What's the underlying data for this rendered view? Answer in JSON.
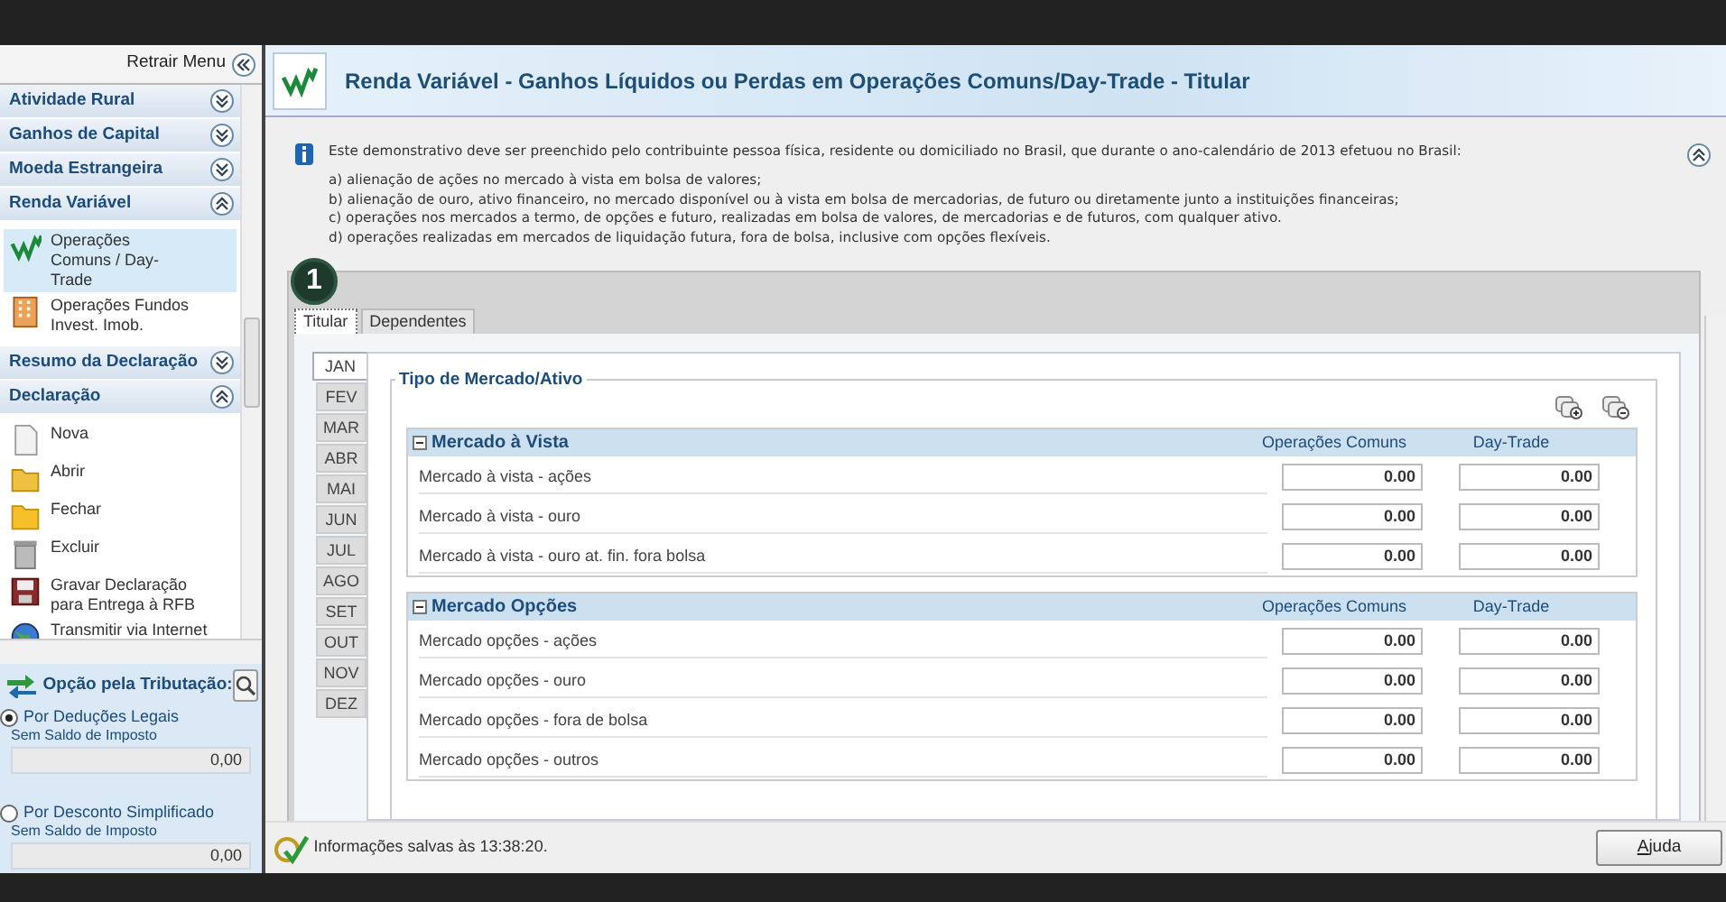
{
  "sidebar": {
    "collapse_label": "Retrair Menu",
    "sections": [
      {
        "title": "Atividade Rural",
        "expanded": false
      },
      {
        "title": "Ganhos de Capital",
        "expanded": false
      },
      {
        "title": "Moeda Estrangeira",
        "expanded": false
      },
      {
        "title": "Renda Variável",
        "expanded": true,
        "items": [
          {
            "label": "Operações Comuns / Day-Trade",
            "selected": true
          },
          {
            "label": "Operações Fundos Invest. Imob.",
            "selected": false
          }
        ]
      },
      {
        "title": "Resumo da Declaração",
        "expanded": false
      },
      {
        "title": "Declaração",
        "expanded": true,
        "items": [
          {
            "label": "Nova",
            "selected": false
          },
          {
            "label": "Abrir",
            "selected": false
          },
          {
            "label": "Fechar",
            "selected": false
          },
          {
            "label": "Excluir",
            "selected": false
          },
          {
            "label": "Gravar Declaração para Entrega à RFB",
            "selected": false
          },
          {
            "label": "Transmitir via Internet",
            "selected": false
          }
        ]
      }
    ]
  },
  "taxation": {
    "title": "Opção pela Tributação:",
    "options": [
      {
        "label": "Por Deduções Legais",
        "selected": true,
        "caption": "Sem Saldo de Imposto",
        "value": "0,00"
      },
      {
        "label": "Por Desconto Simplificado",
        "selected": false,
        "caption": "Sem Saldo de Imposto",
        "value": "0,00"
      }
    ]
  },
  "page": {
    "title": "Renda Variável - Ganhos Líquidos ou Perdas em Operações Comuns/Day-Trade - Titular",
    "info": {
      "intro": "Este demonstrativo deve ser preenchido pelo contribuinte pessoa física, residente ou domiciliado no Brasil, que durante o ano-calendário de 2013 efetuou no Brasil:",
      "lines": [
        "a) alienação de ações no mercado à vista em bolsa de valores;",
        "b) alienação de ouro, ativo financeiro, no mercado disponível ou à vista em bolsa de mercadorias, de futuro ou diretamente junto a instituições financeiras;",
        "c) operações nos mercados a termo, de opções e futuro, realizadas em bolsa de valores, de mercadorias e de futuros, com qualquer ativo.",
        "d) operações realizadas em mercados de liquidação futura, fora de bolsa, inclusive com opções flexíveis."
      ]
    },
    "step_badge": "1",
    "tabs": [
      {
        "label": "Titular",
        "selected": true
      },
      {
        "label": "Dependentes",
        "selected": false
      }
    ],
    "months": [
      {
        "label": "JAN",
        "selected": true
      },
      {
        "label": "FEV",
        "selected": false
      },
      {
        "label": "MAR",
        "selected": false
      },
      {
        "label": "ABR",
        "selected": false
      },
      {
        "label": "MAI",
        "selected": false
      },
      {
        "label": "JUN",
        "selected": false
      },
      {
        "label": "JUL",
        "selected": false
      },
      {
        "label": "AGO",
        "selected": false
      },
      {
        "label": "SET",
        "selected": false
      },
      {
        "label": "OUT",
        "selected": false
      },
      {
        "label": "NOV",
        "selected": false
      },
      {
        "label": "DEZ",
        "selected": false
      }
    ],
    "fieldset_title": "Tipo de Mercado/Ativo",
    "groups": [
      {
        "title": "Mercado à Vista",
        "columns": [
          "Operações Comuns",
          "Day-Trade"
        ],
        "rows": [
          {
            "label": "Mercado à vista - ações",
            "values": [
              "0.00",
              "0.00"
            ]
          },
          {
            "label": "Mercado à vista - ouro",
            "values": [
              "0.00",
              "0.00"
            ]
          },
          {
            "label": "Mercado à vista - ouro at. fin. fora bolsa",
            "values": [
              "0.00",
              "0.00"
            ]
          }
        ]
      },
      {
        "title": "Mercado Opções",
        "columns": [
          "Operações Comuns",
          "Day-Trade"
        ],
        "rows": [
          {
            "label": "Mercado opções - ações",
            "values": [
              "0.00",
              "0.00"
            ]
          },
          {
            "label": "Mercado opções - ouro",
            "values": [
              "0.00",
              "0.00"
            ]
          },
          {
            "label": "Mercado opções - fora de bolsa",
            "values": [
              "0.00",
              "0.00"
            ]
          },
          {
            "label": "Mercado opções - outros",
            "values": [
              "0.00",
              "0.00"
            ]
          }
        ]
      }
    ]
  },
  "status_bar": {
    "message": "Informações salvas às 13:38:20.",
    "help_button": "Ajuda"
  }
}
